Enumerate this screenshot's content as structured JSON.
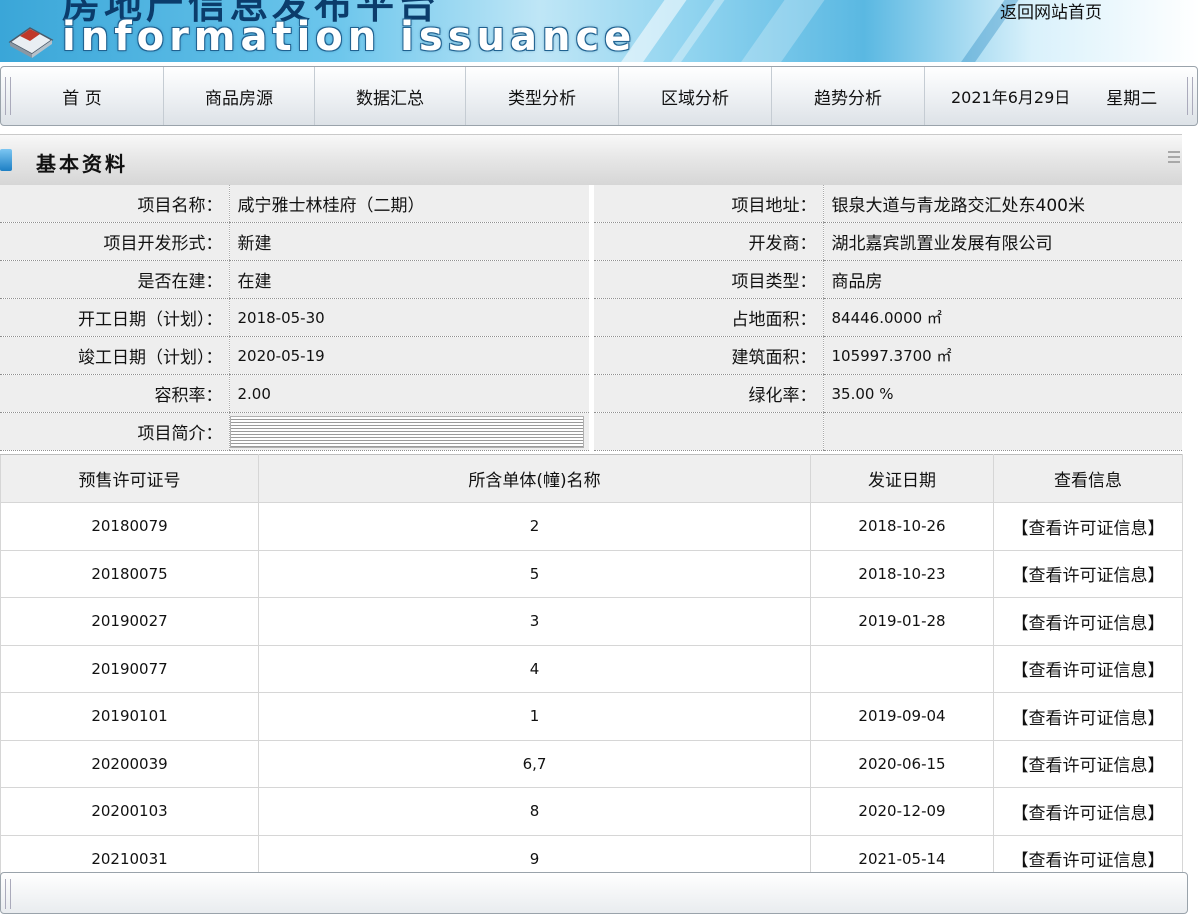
{
  "banner": {
    "title_cn": "房地产信息发布平台",
    "title_en": "information issuance",
    "home_link": "返回网站首页"
  },
  "nav": {
    "items": [
      {
        "label": "首 页"
      },
      {
        "label": "商品房源"
      },
      {
        "label": "数据汇总"
      },
      {
        "label": "类型分析"
      },
      {
        "label": "区域分析"
      },
      {
        "label": "趋势分析"
      }
    ],
    "date": "2021年6月29日",
    "weekday": "星期二"
  },
  "section": {
    "title": "基本资料"
  },
  "info": {
    "project_name_label": "项目名称：",
    "project_name": "咸宁雅士林桂府（二期）",
    "address_label": "项目地址：",
    "address": "银泉大道与青龙路交汇处东400米",
    "dev_form_label": "项目开发形式：",
    "dev_form": "新建",
    "developer_label": "开发商：",
    "developer": "湖北嘉宾凯置业发展有限公司",
    "under_construction_label": "是否在建：",
    "under_construction": "在建",
    "project_type_label": "项目类型：",
    "project_type": "商品房",
    "start_date_label": "开工日期（计划）：",
    "start_date": "2018-05-30",
    "land_area_label": "占地面积：",
    "land_area": "84446.0000 ㎡",
    "completion_date_label": "竣工日期（计划）：",
    "completion_date": "2020-05-19",
    "building_area_label": "建筑面积：",
    "building_area": "105997.3700 ㎡",
    "plot_ratio_label": "容积率：",
    "plot_ratio": "2.00",
    "green_ratio_label": "绿化率：",
    "green_ratio": "35.00 %",
    "intro_label": "项目简介："
  },
  "permits": {
    "headers": [
      "预售许可证号",
      "所含单体(幢)名称",
      "发证日期",
      "查看信息"
    ],
    "link_label": "【查看许可证信息】",
    "rows": [
      {
        "no": "20180079",
        "units": "2",
        "date": "2018-10-26"
      },
      {
        "no": "20180075",
        "units": "5",
        "date": "2018-10-23"
      },
      {
        "no": "20190027",
        "units": "3",
        "date": "2019-01-28"
      },
      {
        "no": "20190077",
        "units": "4",
        "date": ""
      },
      {
        "no": "20190101",
        "units": "1",
        "date": "2019-09-04"
      },
      {
        "no": "20200039",
        "units": "6,7",
        "date": "2020-06-15"
      },
      {
        "no": "20200103",
        "units": "8",
        "date": "2020-12-09"
      },
      {
        "no": "20210031",
        "units": "9",
        "date": "2021-05-14"
      }
    ]
  },
  "colors": {
    "banner_blue": "#3aa6d8",
    "section_marker": "#1d7fc4",
    "table_label_bg": "#eeeeee"
  }
}
